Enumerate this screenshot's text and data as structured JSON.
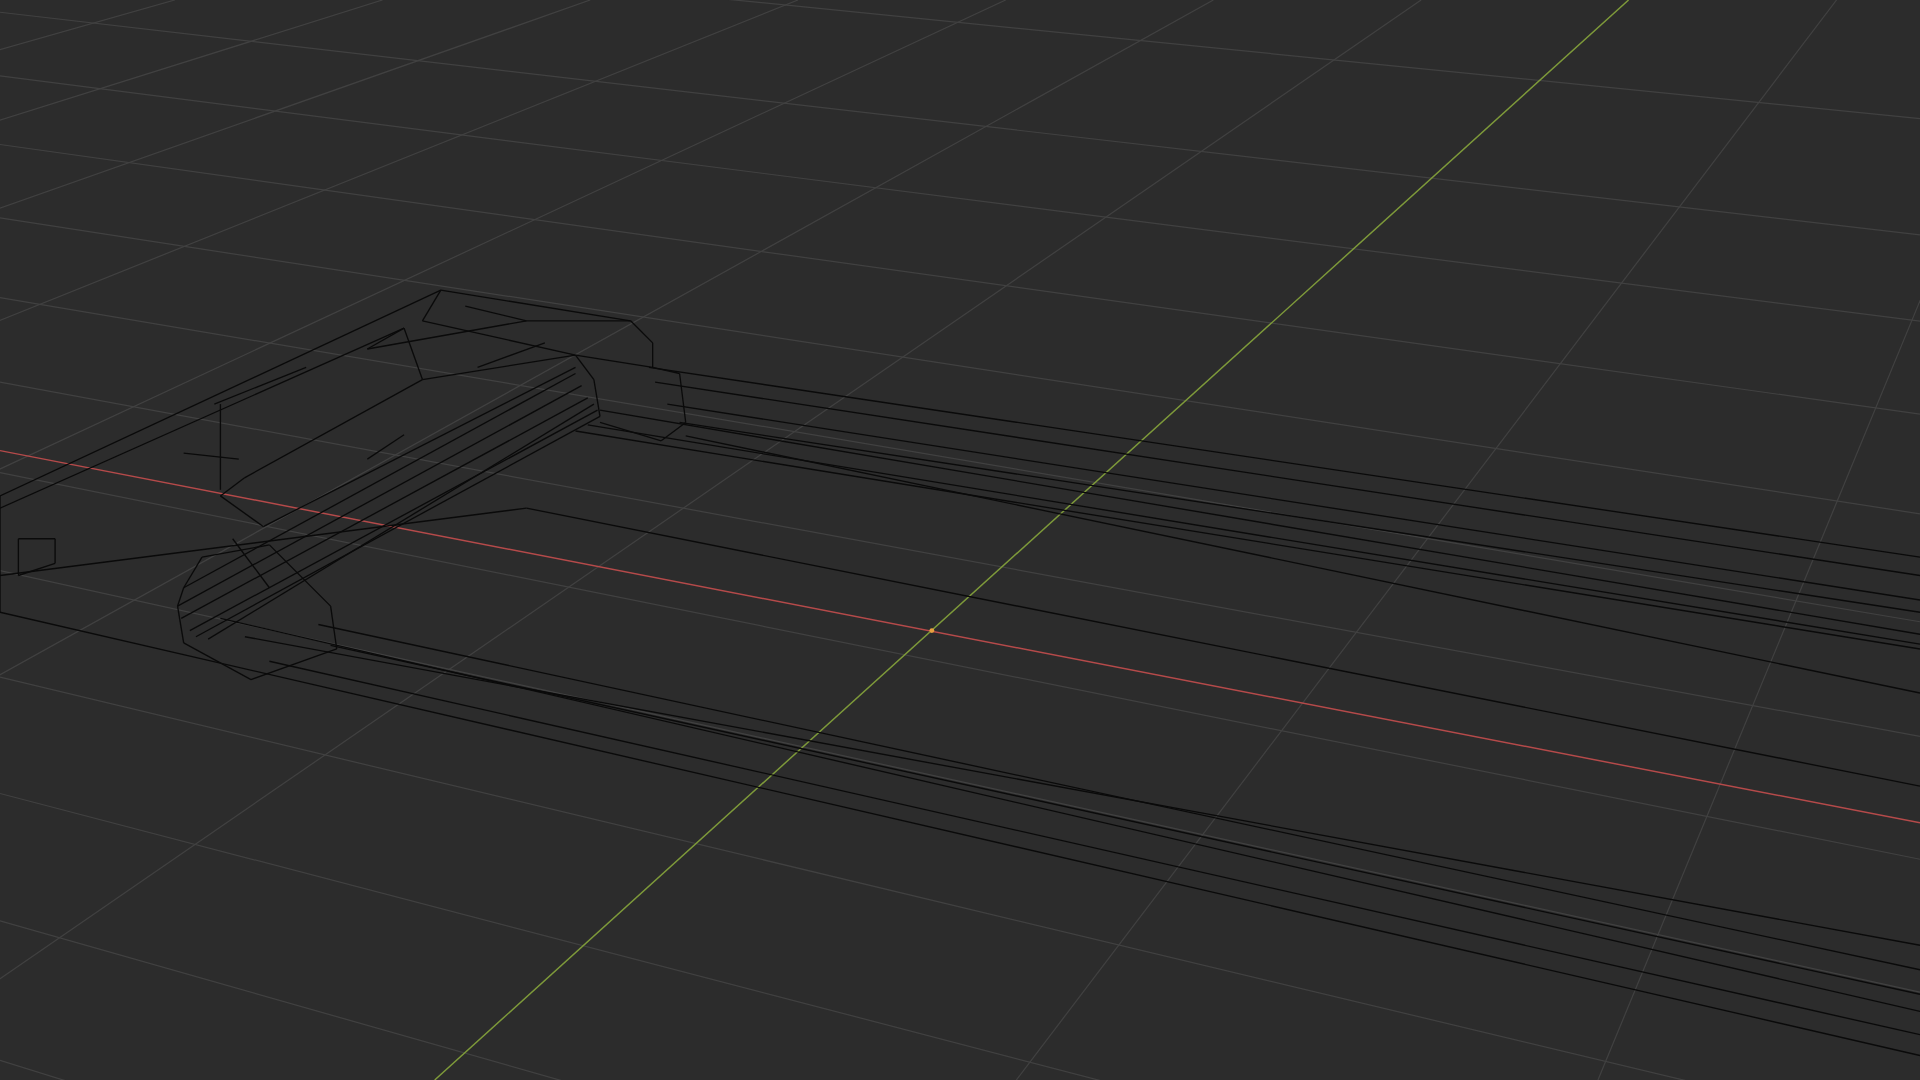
{
  "viewport": {
    "kind": "viewport",
    "wireframe": true,
    "floor_grid": true
  }
}
